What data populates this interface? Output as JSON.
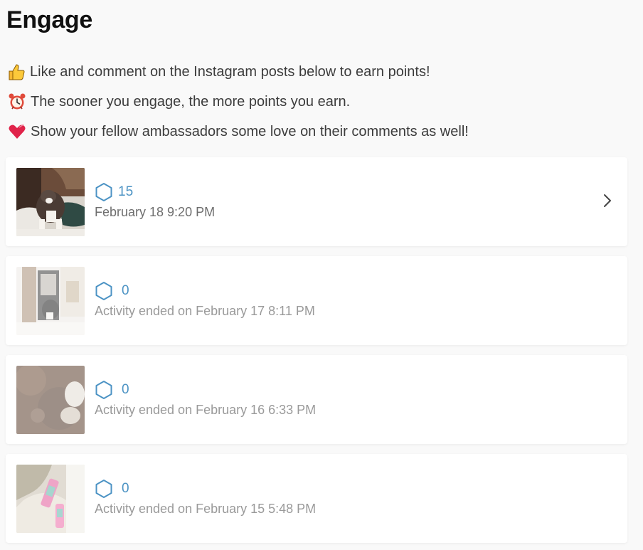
{
  "page": {
    "title": "Engage"
  },
  "tips": [
    {
      "icon": "thumbs-up-icon",
      "text": "Like and comment on the Instagram posts below to earn points!"
    },
    {
      "icon": "alarm-clock-icon",
      "text": "The sooner you engage, the more points you earn."
    },
    {
      "icon": "heart-icon",
      "text": "Show your fellow ambassadors some love on their comments as well!"
    }
  ],
  "posts": [
    {
      "points": "15",
      "date": "February 18 9:20 PM",
      "active": true
    },
    {
      "points": "0",
      "date": "Activity ended on February 17 8:11 PM",
      "active": false
    },
    {
      "points": "0",
      "date": "Activity ended on February 16 6:33 PM",
      "active": false
    },
    {
      "points": "0",
      "date": "Activity ended on February 15 5:48 PM",
      "active": false
    }
  ],
  "colors": {
    "accent": "#4c93c4",
    "text": "#3c3c3c",
    "muted": "#9a9a9a",
    "background": "#f9f9f9"
  }
}
